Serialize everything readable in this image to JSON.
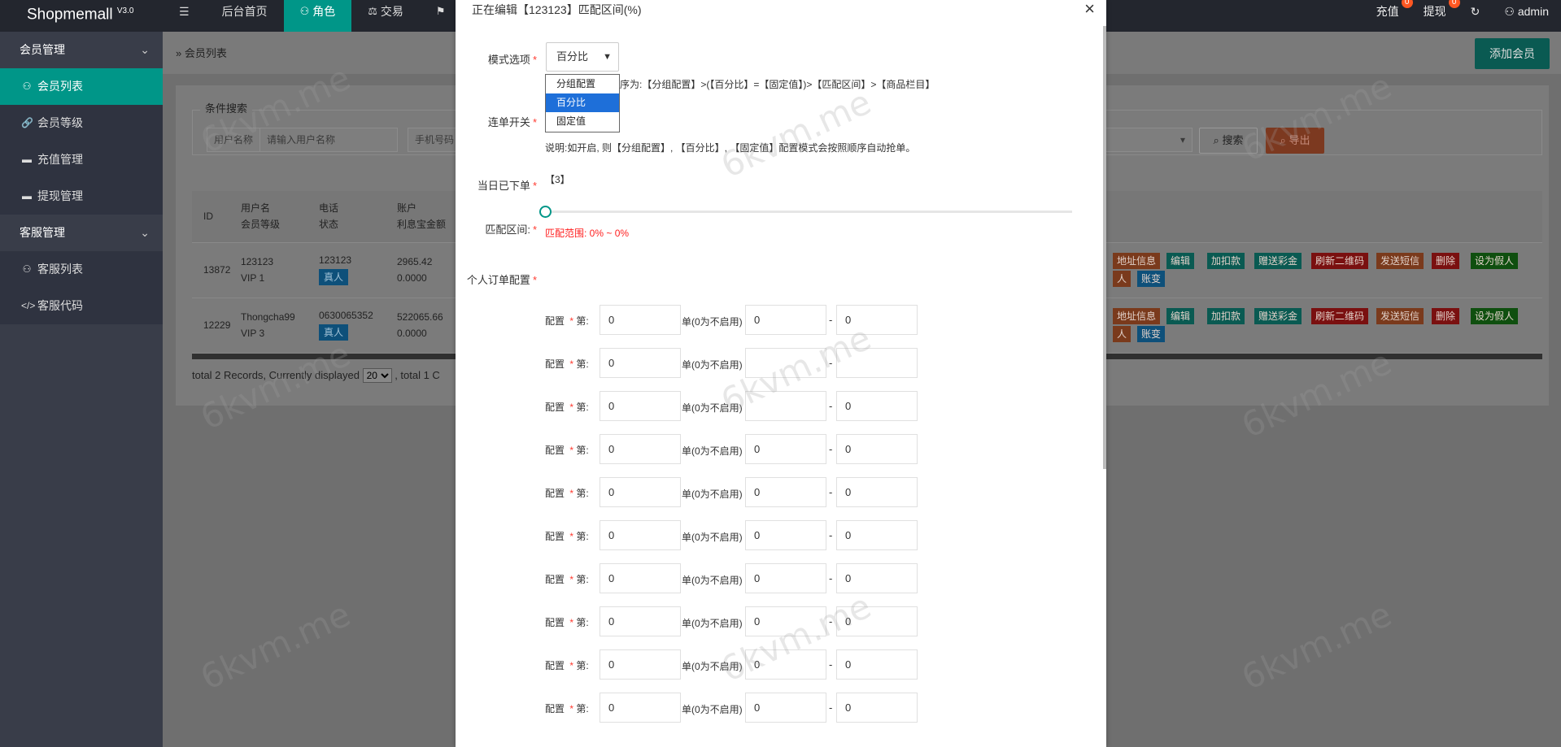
{
  "header": {
    "logo": "Shopmemall",
    "version": "V3.0",
    "menu_icon": "☰",
    "nav": [
      {
        "label": "后台首页",
        "icon": ""
      },
      {
        "label": "角色",
        "icon": "user-icon"
      },
      {
        "label": "交易",
        "icon": "scale-icon"
      },
      {
        "label": "",
        "icon": "flag-icon"
      }
    ],
    "right": {
      "recharge": "充值",
      "recharge_badge": "0",
      "withdraw": "提现",
      "withdraw_badge": "0",
      "user": "admin"
    }
  },
  "sidebar": {
    "groups": [
      {
        "label": "会员管理",
        "items": [
          "会员列表",
          "会员等级",
          "充值管理",
          "提现管理"
        ]
      },
      {
        "label": "客服管理",
        "items": [
          "客服列表",
          "客服代码"
        ]
      }
    ]
  },
  "main": {
    "breadcrumb": "会员列表",
    "add_member": "添加会员",
    "search_legend": "条件搜索",
    "search": {
      "username_label": "用户名称",
      "username_placeholder": "请输入用户名称",
      "phone_label": "手机号码",
      "search_btn": "搜索",
      "export_btn": "导出"
    },
    "table": {
      "headers": {
        "id": "ID",
        "user_1": "用户名",
        "user_2": "会员等级",
        "phone_1": "电话",
        "phone_2": "状态",
        "acct_1": "账户",
        "acct_2": "利息宝金额"
      },
      "rows": [
        {
          "id": "13872",
          "name": "123123",
          "level": "VIP 1",
          "phone": "123123",
          "status": "真人",
          "balance": "2965.42",
          "interest": "0.0000"
        },
        {
          "id": "12229",
          "name": "Thongcha99",
          "level": "VIP 3",
          "phone": "0630065352",
          "status": "真人",
          "balance": "522065.66",
          "interest": "0.0000"
        }
      ],
      "actions": {
        "address": "地址信息",
        "edit": "编辑",
        "add_deduct": "加扣款",
        "gift": "赠送彩金",
        "refresh_qr": "刷新二维码",
        "sms": "发送短信",
        "delete": "删除",
        "fake": "设为假人",
        "human": "人",
        "ledger": "账变"
      }
    },
    "pager": {
      "prefix": "total 2 Records,  Currently displayed",
      "page_size": "20",
      "suffix": ",  total 1 C"
    }
  },
  "modal": {
    "title": "正在编辑【123123】匹配区间(%)",
    "close": "×",
    "mode_label": "模式选项",
    "mode_value": "百分比",
    "mode_options": [
      "分组配置",
      "百分比",
      "固定值"
    ],
    "priority_note": "序为:【分组配置】>(【百分比】=【固定值】)>【匹配区间】>【商品栏目】",
    "combo_label": "连单开关",
    "combo_note": "说明:如开启, 则【分组配置】, 【百分比】, 【固定值】配置模式会按照顺序自动抢单。",
    "today_label": "当日已下单",
    "today_value": "【3】",
    "range_label": "匹配区间:",
    "range_text": "匹配范围: 0% ~ 0%",
    "range_value_percent": 0,
    "personal_label": "个人订单配置",
    "config_label": "配置",
    "config_nth": "第:",
    "config_mid": "单(0为不启用)",
    "config_rows": [
      {
        "nth": "0",
        "from": "0",
        "to": "0"
      },
      {
        "nth": "0",
        "from": "",
        "to": ""
      },
      {
        "nth": "0",
        "from": "",
        "to": "0"
      },
      {
        "nth": "0",
        "from": "0",
        "to": "0"
      },
      {
        "nth": "0",
        "from": "0",
        "to": "0"
      },
      {
        "nth": "0",
        "from": "0",
        "to": "0"
      },
      {
        "nth": "0",
        "from": "0",
        "to": "0"
      },
      {
        "nth": "0",
        "from": "0",
        "to": "0"
      },
      {
        "nth": "0",
        "from": "0",
        "to": "0"
      },
      {
        "nth": "0",
        "from": "0",
        "to": "0"
      }
    ],
    "dash": "-"
  },
  "watermark": "6kvm.me"
}
